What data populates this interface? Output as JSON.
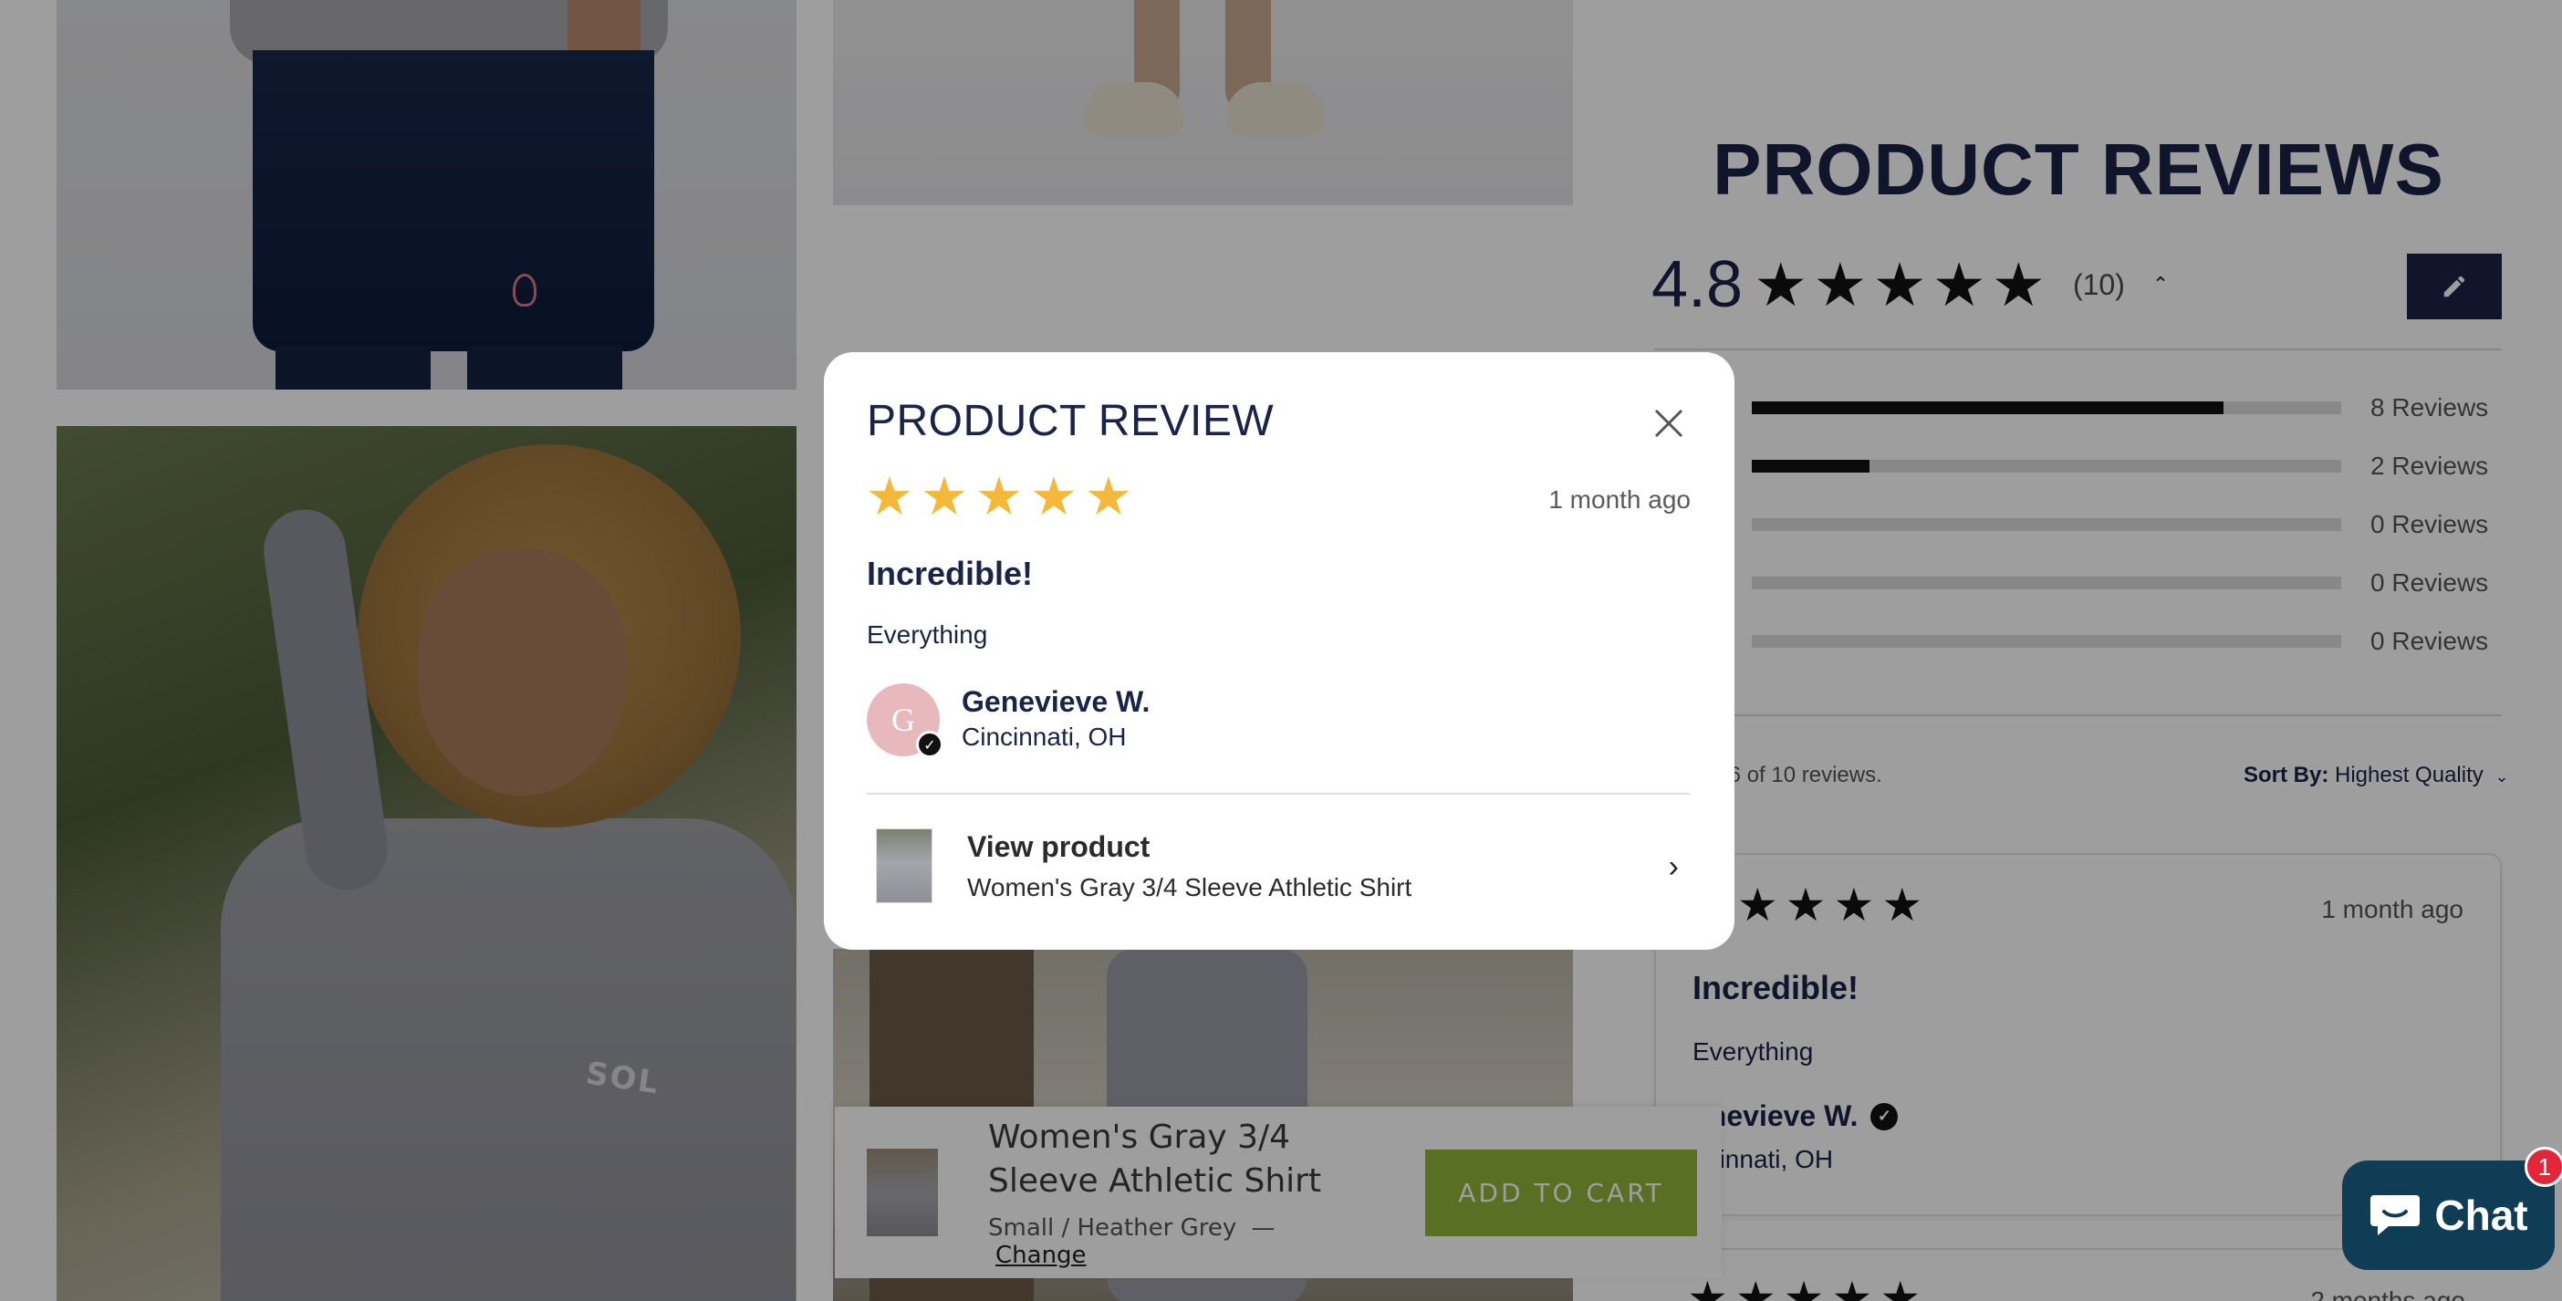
{
  "reviews_section": {
    "title": "PRODUCT REVIEWS",
    "average": "4.8",
    "count": "(10)",
    "distribution": [
      {
        "label": "8 Reviews",
        "fraction": 0.8
      },
      {
        "label": "2 Reviews",
        "fraction": 0.2
      },
      {
        "label": "0 Reviews",
        "fraction": 0
      },
      {
        "label": "0 Reviews",
        "fraction": 0
      },
      {
        "label": "0 Reviews",
        "fraction": 0
      }
    ],
    "showing": "1 - 6 of 10 reviews.",
    "sort_label": "Sort By:",
    "sort_value": "Highest Quality",
    "card": {
      "date": "1 month ago",
      "title": "Incredible!",
      "body": "Everything",
      "name": "enevieve W.",
      "location": "ncinnati, OH"
    },
    "next_card_date": "2 months ago"
  },
  "sticky_bar": {
    "product_name": "Women's Gray 3/4 Sleeve Athletic Shirt",
    "variant": "Small / Heather Grey",
    "separator": "—",
    "change_label": "Change",
    "add_to_cart": "ADD TO CART"
  },
  "chat": {
    "label": "Chat",
    "badge": "1"
  },
  "modal": {
    "title": "PRODUCT REVIEW",
    "rating": 5,
    "date": "1 month ago",
    "review_title": "Incredible!",
    "body": "Everything",
    "avatar_initial": "G",
    "name": "Genevieve W.",
    "location": "Cincinnati, OH",
    "view_product": "View product",
    "product_name": "Women's Gray 3/4 Sleeve Athletic Shirt"
  },
  "colors": {
    "navy": "#1a2348",
    "star_gold": "#f4b93a",
    "add_to_cart_green": "#8fb33a",
    "chat_bg": "#0f3d55"
  },
  "icons": {
    "close": "close-icon",
    "edit": "pencil-icon",
    "chevron": "chevron-right-icon",
    "verified": "verified-check-icon",
    "chat": "chat-bubble-icon"
  }
}
